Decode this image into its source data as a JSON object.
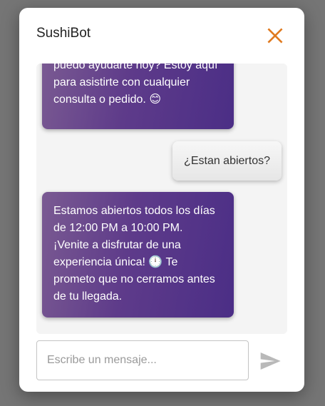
{
  "dialog": {
    "title": "SushiBot",
    "close_icon": "close-icon",
    "accent_color": "#e07a1f"
  },
  "messages": [
    {
      "sender": "bot",
      "lines": [
        "puedo ayudarte hoy? Estoy aquí",
        "para asistirte con cualquier",
        "consulta o pedido. 😊"
      ]
    },
    {
      "sender": "user",
      "lines": [
        "¿Estan abiertos?"
      ]
    },
    {
      "sender": "bot",
      "lines": [
        "Estamos abiertos todos los días",
        "de 12:00 PM a 10:00 PM.",
        "¡Venite a disfrutar de una",
        "experiencia única! 🕛 Te",
        "prometo que no cerramos antes",
        "de tu llegada."
      ]
    }
  ],
  "composer": {
    "placeholder": "Escribe un mensaje...",
    "value": "",
    "send_icon": "send-icon"
  },
  "colors": {
    "bot_bubble": "#5e3b8a",
    "user_bubble": "#ececec",
    "overlay": "#757575"
  }
}
